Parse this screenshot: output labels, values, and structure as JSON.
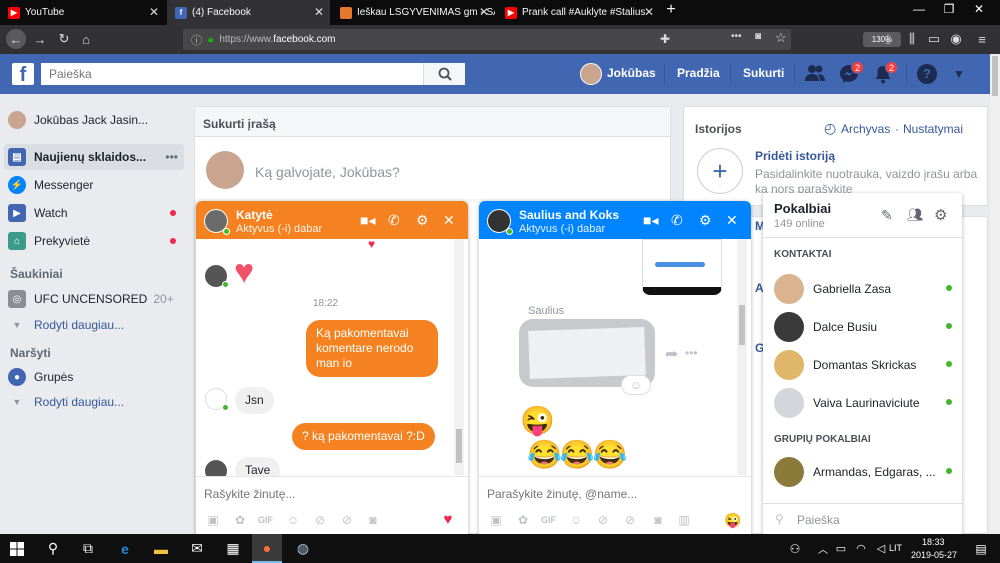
{
  "browser": {
    "tabs": [
      {
        "label": "YouTube",
        "icon_color": "#ff0000"
      },
      {
        "label": "(4) Facebook",
        "icon_color": "#4267b2"
      },
      {
        "label": "Ieškau LSGYVENIMAS gm - SA",
        "icon_color": "#e8772e"
      },
      {
        "label": "Prank call #Auklyte #Stalius",
        "icon_color": "#ff0000"
      }
    ],
    "url_prefix": "https://www.",
    "url_domain": "facebook.com",
    "zoom": "130%"
  },
  "header": {
    "search_placeholder": "Paieška",
    "user_name": "Jokūbas",
    "home": "Pradžia",
    "create": "Sukurti",
    "messenger_badge": "2",
    "notifications_badge": "2"
  },
  "sidebar": {
    "profile_name": "Jokūbas Jack Jasin...",
    "items": [
      {
        "label": "Naujienų sklaidos...",
        "bold": true
      },
      {
        "label": "Messenger"
      },
      {
        "label": "Watch"
      },
      {
        "label": "Prekyvietė"
      }
    ],
    "shortcuts_title": "Šaukiniai",
    "shortcut": "UFC UNCENSORED",
    "shortcut_count": "20+",
    "show_more": "Rodyti daugiau...",
    "explore_title": "Naršyti",
    "groups": "Grupės",
    "show_more_2": "Rodyti daugiau..."
  },
  "composer": {
    "title": "Sukurti įrašą",
    "placeholder": "Ką galvojate, Jokūbas?"
  },
  "stories": {
    "title": "Istorijos",
    "archive": "Archyvas",
    "settings": "Nustatymai",
    "add_title": "Pridėti istoriją",
    "add_desc": "Pasidalinkite nuotrauka, vaizdo įrašu arba ka nors parašykite"
  },
  "chat1": {
    "name": "Katytė",
    "status": "Aktyvus (-i) dabar",
    "time": "18:22",
    "messages": [
      "Ką pakomentavai komentare nerodo man io",
      "Jsn",
      "? ką pakomentavai ?:D",
      "Tave"
    ],
    "input_placeholder": "Rašykite žinutę..."
  },
  "chat2": {
    "name": "Saulius and Koks",
    "status": "Aktyvus (-i) dabar",
    "sender": "Saulius",
    "input_placeholder": "Parašykite žinutę, @name..."
  },
  "contacts": {
    "title": "Pokalbiai",
    "online_count": "149 online",
    "section": "KONTAKTAI",
    "people": [
      "Gabriella Zasa",
      "Dalce Busiu",
      "Domantas Skrickas",
      "Vaiva Laurinaviciute"
    ],
    "group_section": "GRUPIŲ POKALBIAI",
    "group": "Armandas, Edgaras, ...",
    "search_placeholder": "Paieška"
  },
  "taskbar": {
    "time": "18:33",
    "date": "2019-05-27",
    "lang": "LIT"
  },
  "colors": {
    "fb_blue": "#4267b2",
    "chat1_accent": "#f58220",
    "chat2_accent": "#0084ff"
  }
}
